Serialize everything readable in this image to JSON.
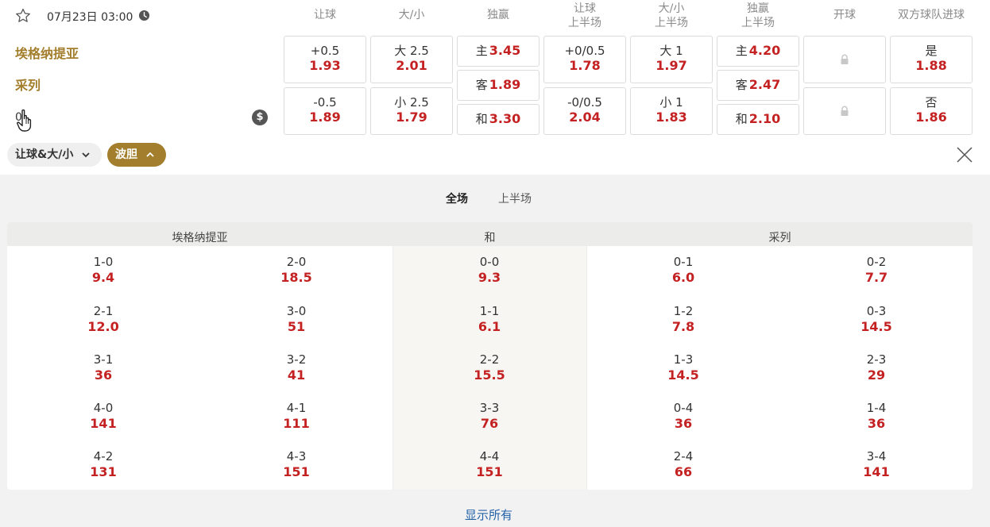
{
  "match": {
    "datetime": "07月23日 03:00",
    "home_team": "埃格纳提亚",
    "away_team": "采列",
    "live_clock": "0"
  },
  "columns": [
    "让球",
    "大/小",
    "独赢",
    "让球\n上半场",
    "大/小\n上半场",
    "独赢\n上半场",
    "开球",
    "双方球队进球"
  ],
  "odds": {
    "handicap": [
      {
        "label": "+0.5",
        "odd": "1.93"
      },
      {
        "label": "-0.5",
        "odd": "1.89"
      }
    ],
    "over_under": [
      {
        "label": "大 2.5",
        "odd": "2.01"
      },
      {
        "label": "小 2.5",
        "odd": "1.79"
      }
    ],
    "moneyline": [
      {
        "label": "主",
        "odd": "3.45"
      },
      {
        "label": "客",
        "odd": "1.89"
      },
      {
        "label": "和",
        "odd": "3.30"
      }
    ],
    "handicap_1h": [
      {
        "label": "+0/0.5",
        "odd": "1.78"
      },
      {
        "label": "-0/0.5",
        "odd": "2.04"
      }
    ],
    "over_under_1h": [
      {
        "label": "大 1",
        "odd": "1.97"
      },
      {
        "label": "小 1",
        "odd": "1.83"
      }
    ],
    "moneyline_1h": [
      {
        "label": "主",
        "odd": "4.20"
      },
      {
        "label": "客",
        "odd": "2.47"
      },
      {
        "label": "和",
        "odd": "2.10"
      }
    ],
    "btts": [
      {
        "label": "是",
        "odd": "1.88"
      },
      {
        "label": "否",
        "odd": "1.86"
      }
    ]
  },
  "filters": {
    "handicap_ou": "让球&大/小",
    "correct_score": "波胆"
  },
  "tabs": {
    "full": "全场",
    "first_half": "上半场"
  },
  "correct_score": {
    "headers": {
      "home": "埃格纳提亚",
      "draw": "和",
      "away": "采列"
    },
    "home_col1": [
      {
        "score": "1-0",
        "odd": "9.4"
      },
      {
        "score": "2-1",
        "odd": "12.0"
      },
      {
        "score": "3-1",
        "odd": "36"
      },
      {
        "score": "4-0",
        "odd": "141"
      },
      {
        "score": "4-2",
        "odd": "131"
      }
    ],
    "home_col2": [
      {
        "score": "2-0",
        "odd": "18.5"
      },
      {
        "score": "3-0",
        "odd": "51"
      },
      {
        "score": "3-2",
        "odd": "41"
      },
      {
        "score": "4-1",
        "odd": "111"
      },
      {
        "score": "4-3",
        "odd": "151"
      }
    ],
    "draw": [
      {
        "score": "0-0",
        "odd": "9.3"
      },
      {
        "score": "1-1",
        "odd": "6.1"
      },
      {
        "score": "2-2",
        "odd": "15.5"
      },
      {
        "score": "3-3",
        "odd": "76"
      },
      {
        "score": "4-4",
        "odd": "151"
      }
    ],
    "away_col1": [
      {
        "score": "0-1",
        "odd": "6.0"
      },
      {
        "score": "1-2",
        "odd": "7.8"
      },
      {
        "score": "1-3",
        "odd": "14.5"
      },
      {
        "score": "0-4",
        "odd": "36"
      },
      {
        "score": "2-4",
        "odd": "66"
      }
    ],
    "away_col2": [
      {
        "score": "0-2",
        "odd": "7.7"
      },
      {
        "score": "0-3",
        "odd": "14.5"
      },
      {
        "score": "2-3",
        "odd": "29"
      },
      {
        "score": "1-4",
        "odd": "36"
      },
      {
        "score": "3-4",
        "odd": "141"
      }
    ]
  },
  "show_all": "显示所有",
  "colors": {
    "accent": "#a37e2c",
    "odds": "#c42222",
    "link": "#2462a8"
  }
}
